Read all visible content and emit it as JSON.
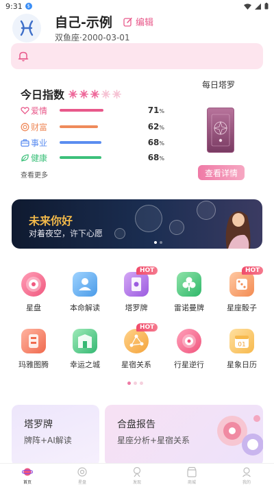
{
  "status": {
    "time": "9:31"
  },
  "profile": {
    "name": "自己-示例",
    "edit_label": "编辑",
    "birth": "双鱼座·2000-03-01"
  },
  "colors": {
    "accent": "#ee7aa5",
    "love": "#e8588a",
    "wealth": "#ef8a5a",
    "career": "#5b8df0",
    "health": "#3cc07a"
  },
  "today": {
    "title": "今日指数",
    "stars_rating": 3,
    "stars_total": 5,
    "metrics": [
      {
        "label": "爱情",
        "value": "71",
        "unit": "%",
        "icon": "heart-icon",
        "color": "#e8588a"
      },
      {
        "label": "财富",
        "value": "62",
        "unit": "%",
        "icon": "coin-icon",
        "color": "#ef8a5a"
      },
      {
        "label": "事业",
        "value": "68",
        "unit": "%",
        "icon": "briefcase-icon",
        "color": "#5b8df0"
      },
      {
        "label": "健康",
        "value": "68",
        "unit": "%",
        "icon": "leaf-icon",
        "color": "#3cc07a"
      }
    ],
    "more_label": "查看更多"
  },
  "daily_tarot": {
    "title": "每日塔罗",
    "button_label": "查看详情"
  },
  "banner": {
    "title": "未来你好",
    "subtitle": "对着夜空，许下心愿",
    "slide_count": 2,
    "active_slide": 1
  },
  "features": [
    {
      "label": "星盘",
      "icon": "astrolabe-icon",
      "hot": false
    },
    {
      "label": "本命解读",
      "icon": "person-icon",
      "hot": false
    },
    {
      "label": "塔罗牌",
      "icon": "tarot-icon",
      "hot": true,
      "badge": "HOT"
    },
    {
      "label": "雷诺曼牌",
      "icon": "clover-icon",
      "hot": false
    },
    {
      "label": "星座骰子",
      "icon": "dice-icon",
      "hot": true,
      "badge": "HOT"
    },
    {
      "label": "玛雅图腾",
      "icon": "totem-icon",
      "hot": false
    },
    {
      "label": "幸运之城",
      "icon": "city-icon",
      "hot": false
    },
    {
      "label": "星宿关系",
      "icon": "constellation-icon",
      "hot": true,
      "badge": "HOT"
    },
    {
      "label": "行星逆行",
      "icon": "planet-icon",
      "hot": false
    },
    {
      "label": "星象日历",
      "icon": "calendar-icon",
      "hot": false,
      "calendar_day": "01"
    }
  ],
  "cards": [
    {
      "title": "塔罗牌",
      "subtitle": "牌阵+AI解读"
    },
    {
      "title": "合盘报告",
      "subtitle": "星座分析+星宿关系"
    }
  ],
  "tabs": [
    {
      "label": "首页",
      "icon": "home-planet-icon",
      "active": true
    },
    {
      "label": "星盘",
      "icon": "astrolabe-tab-icon",
      "active": false
    },
    {
      "label": "发现",
      "icon": "discover-icon",
      "active": false
    },
    {
      "label": "商城",
      "icon": "shop-icon",
      "active": false
    },
    {
      "label": "我的",
      "icon": "profile-icon",
      "active": false
    }
  ]
}
